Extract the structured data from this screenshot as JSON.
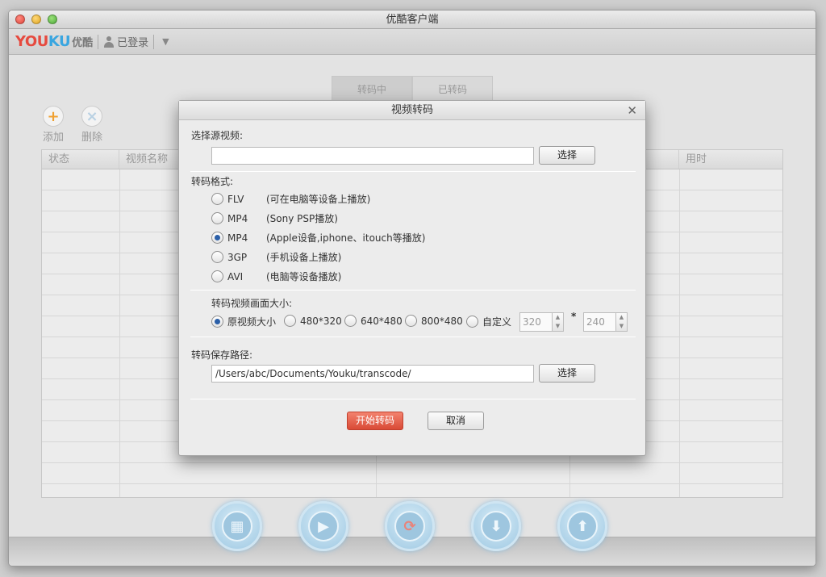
{
  "window": {
    "title": "优酷客户端"
  },
  "toolbar": {
    "logo_you": "YOU",
    "logo_ku": "KU",
    "logo_cn": "优酷",
    "login_status": "已登录"
  },
  "tabs": [
    {
      "label": "转码中"
    },
    {
      "label": "已转码"
    }
  ],
  "actions": {
    "add_label": "添加",
    "delete_label": "删除"
  },
  "grid": {
    "headers": {
      "status": "状态",
      "name": "视频名称",
      "elapsed": "用时"
    }
  },
  "dialog": {
    "title": "视频转码",
    "source_label": "选择源视频:",
    "source_value": "",
    "choose_label": "选择",
    "format_label": "转码格式:",
    "formats": [
      {
        "name": "FLV",
        "desc": "(可在电脑等设备上播放)",
        "checked": false
      },
      {
        "name": "MP4",
        "desc": "(Sony PSP播放)",
        "checked": false
      },
      {
        "name": "MP4",
        "desc": "(Apple设备,iphone、itouch等播放)",
        "checked": true
      },
      {
        "name": "3GP",
        "desc": "(手机设备上播放)",
        "checked": false
      },
      {
        "name": "AVI",
        "desc": "(电脑等设备播放)",
        "checked": false
      }
    ],
    "size_label": "转码视频画面大小:",
    "sizes": [
      {
        "label": "原视频大小",
        "checked": true
      },
      {
        "label": "480*320",
        "checked": false
      },
      {
        "label": "640*480",
        "checked": false
      },
      {
        "label": "800*480",
        "checked": false
      },
      {
        "label": "自定义",
        "checked": false
      }
    ],
    "custom_width": "320",
    "custom_height": "240",
    "times": "*",
    "path_label": "转码保存路径:",
    "path_value": "/Users/abc/Documents/Youku/transcode/",
    "start_label": "开始转码",
    "cancel_label": "取消"
  },
  "colors": {
    "accent": "#d94a36",
    "brand_red": "#e64a3f",
    "brand_blue": "#3aa6e0"
  }
}
